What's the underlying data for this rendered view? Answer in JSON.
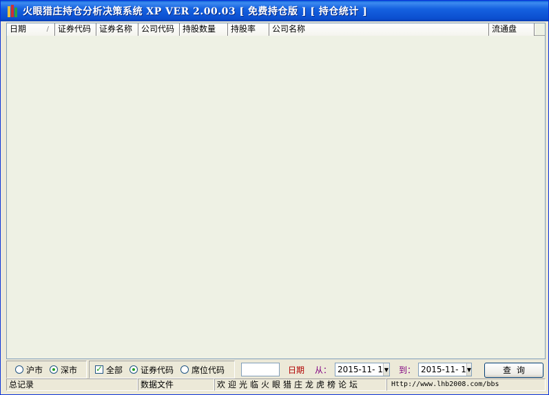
{
  "window": {
    "title": "火眼猎庄持仓分析决策系统 XP  VER 2.00.03 [ 免费持仓版 ] [ 持仓统计 ]"
  },
  "grid": {
    "columns": [
      "日期",
      "证券代码",
      "证券名称",
      "公司代码",
      "持股数量",
      "持股率",
      "公司名称",
      "流通盘"
    ],
    "sort_indicator": "/",
    "rows": []
  },
  "toolbar": {
    "market_sh": "沪市",
    "market_sz": "深市",
    "market_selected": "深市",
    "all_label": "全部",
    "all_checked": true,
    "code_type_security": "证券代码",
    "code_type_seat": "席位代码",
    "code_type_selected": "证券代码",
    "search_value": "",
    "date_label": "日期",
    "from_label": "从：",
    "to_label": "到：",
    "date_from": "2015-11- 1",
    "date_to": "2015-11- 1",
    "query_label": "查询",
    "date_label_color": "#b00000",
    "from_label_color": "#800080"
  },
  "statusbar": {
    "total_records": "总记录",
    "data_file": "数据文件",
    "welcome": "欢迎光临火眼猎庄龙虎榜论坛",
    "url": "Http://www.lhb2008.com/bbs"
  }
}
